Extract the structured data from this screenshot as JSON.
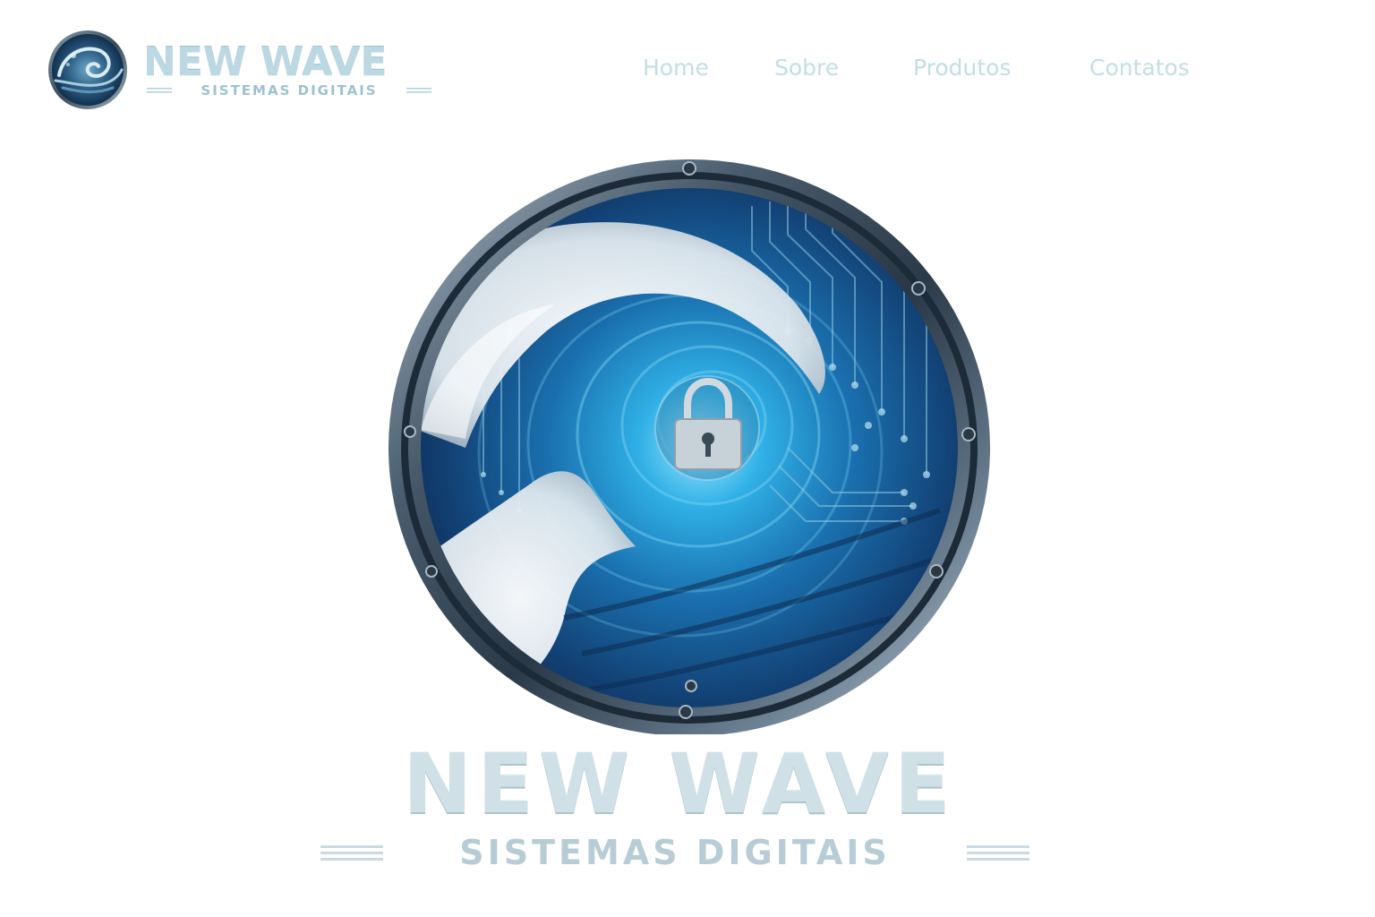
{
  "header": {
    "logo": {
      "title": "NEW WAVE",
      "subtitle": "SISTEMAS DIGITAIS",
      "icon": "wave-logo-icon"
    },
    "nav": [
      {
        "label": "Home"
      },
      {
        "label": "Sobre"
      },
      {
        "label": "Produtos"
      },
      {
        "label": "Contatos"
      }
    ]
  },
  "hero": {
    "emblem": {
      "icon": "wave-porthole-lock-emblem",
      "lock_icon": "padlock-icon"
    },
    "title": "NEW WAVE",
    "subtitle": "SISTEMAS DIGITAIS"
  },
  "colors": {
    "nav_text": "#c2dde6",
    "logo_text": "#bcd8e3",
    "wave_deep": "#0d3a66",
    "wave_light": "#2ba6d9",
    "ring_metal": "#3d4f60",
    "background": "#ffffff"
  }
}
